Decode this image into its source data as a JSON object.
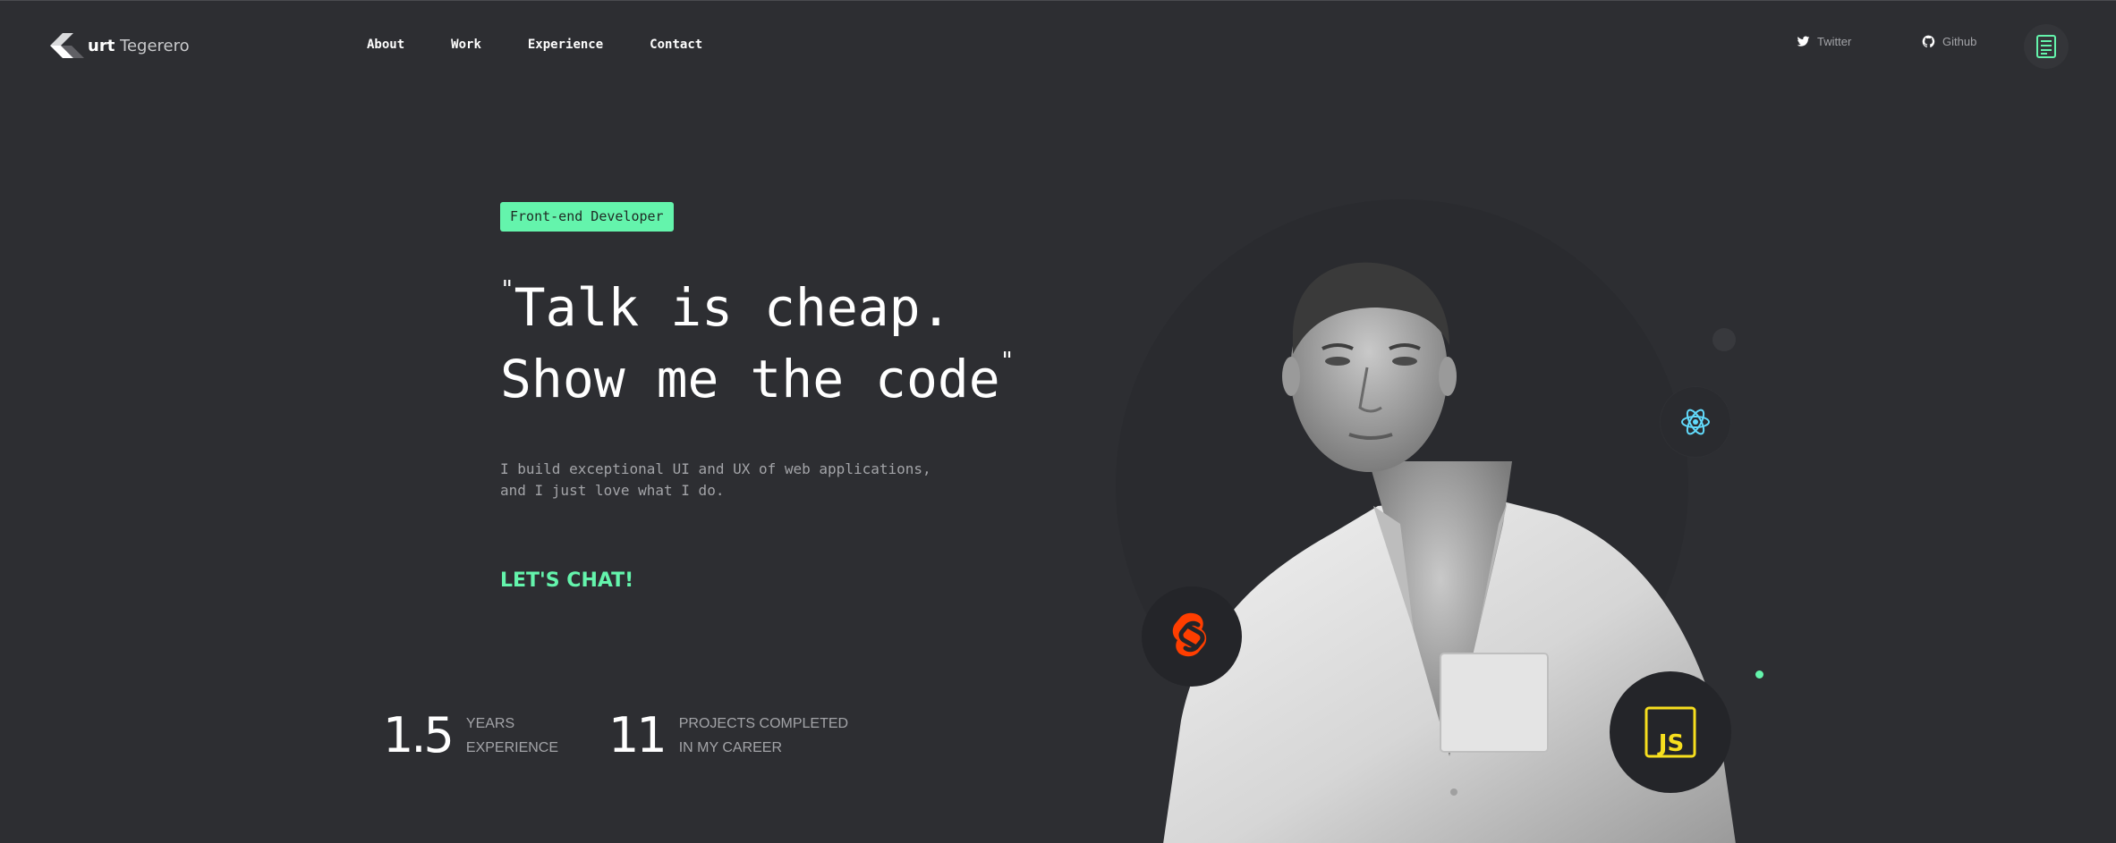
{
  "header": {
    "logo": {
      "bold": "urt",
      "rest": " Tegerero"
    },
    "nav": [
      {
        "label": "About"
      },
      {
        "label": "Work"
      },
      {
        "label": "Experience"
      },
      {
        "label": "Contact"
      }
    ],
    "social": {
      "twitter_label": "Twitter",
      "github_label": "Github"
    },
    "resume_icon": "document-icon"
  },
  "hero": {
    "tag": "Front-end Developer",
    "headline_line1": "Talk is cheap.",
    "headline_line2": "Show me the code",
    "open_quote": "\"",
    "close_quote": "\"",
    "description_line1": "I build exceptional UI and UX of web applications,",
    "description_line2": "and I just love what I do.",
    "cta": "LET'S CHAT!"
  },
  "stats": [
    {
      "value": "1.5",
      "label_line1": "YEARS",
      "label_line2": "EXPERIENCE"
    },
    {
      "value": "11",
      "label_line1": "PROJECTS COMPLETED",
      "label_line2": "IN MY CAREER"
    }
  ],
  "tech_badges": [
    {
      "icon": "react-icon",
      "color": "#61dafb"
    },
    {
      "icon": "svelte-icon",
      "color": "#ff3e00"
    },
    {
      "icon": "javascript-icon",
      "color": "#f7df1e",
      "text": "JS"
    }
  ],
  "colors": {
    "background": "#2d2e32",
    "accent": "#64f4ac",
    "muted_text": "#a3a4a8"
  }
}
